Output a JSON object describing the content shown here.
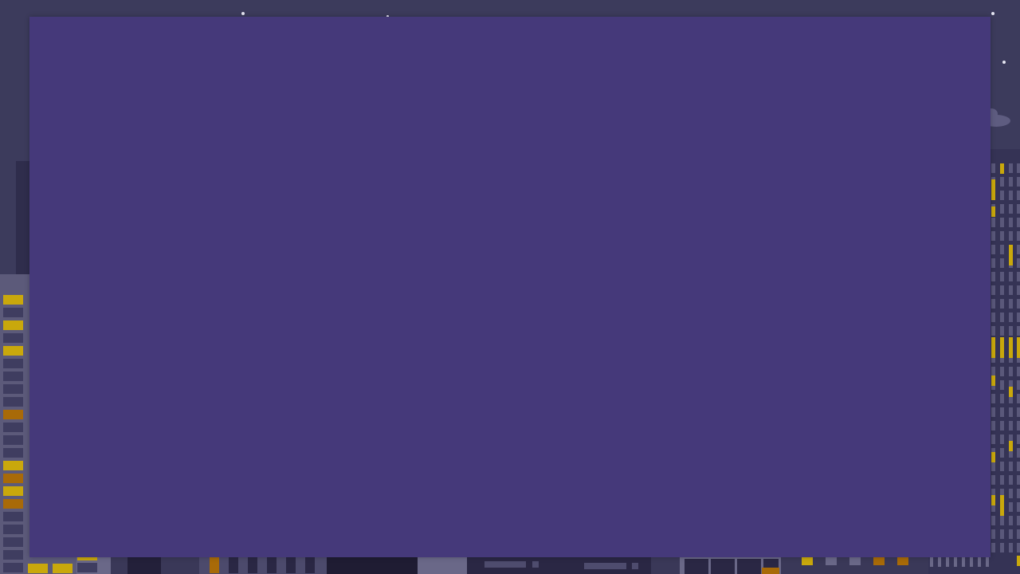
{
  "scene": {
    "description_icon": "city-night-icon",
    "colors": {
      "sky": "#3c3b5c",
      "modal": "#45397a",
      "window_lit_yellow": "#c9a80c",
      "window_lit_orange": "#a86a08",
      "window_dark": "#3f3d60",
      "building_light": "#6a6888",
      "building_dark": "#23203a"
    }
  },
  "modal": {}
}
